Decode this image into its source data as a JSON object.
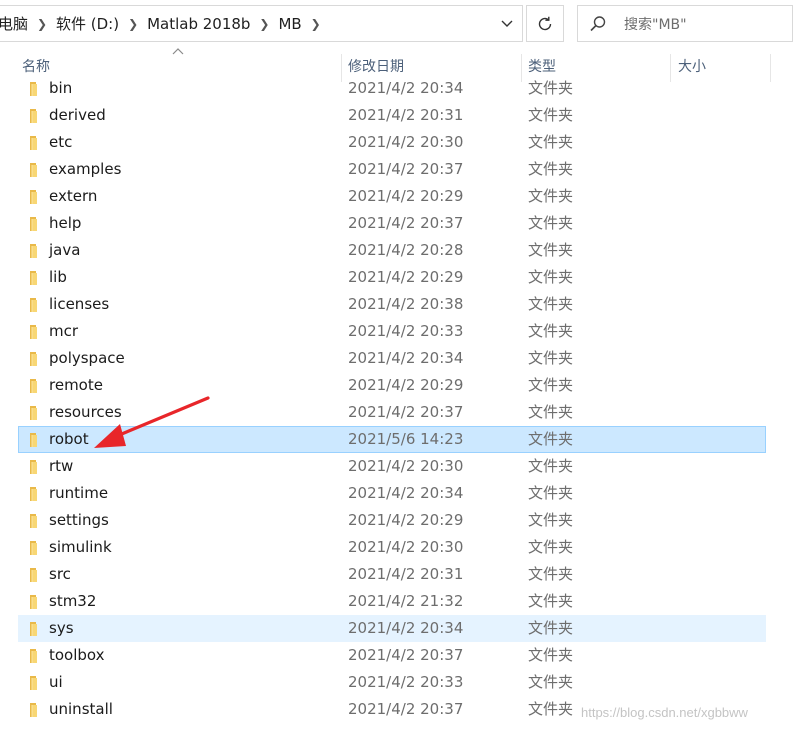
{
  "address": {
    "crumbs": [
      "电脑",
      "软件 (D:)",
      "Matlab 2018b",
      "MB"
    ]
  },
  "search": {
    "placeholder": "搜索\"MB\""
  },
  "columns": {
    "name": "名称",
    "date": "修改日期",
    "type": "类型",
    "size": "大小"
  },
  "rows": [
    {
      "name": "bin",
      "date": "2021/4/2 20:34",
      "type": "文件夹"
    },
    {
      "name": "derived",
      "date": "2021/4/2 20:31",
      "type": "文件夹"
    },
    {
      "name": "etc",
      "date": "2021/4/2 20:30",
      "type": "文件夹"
    },
    {
      "name": "examples",
      "date": "2021/4/2 20:37",
      "type": "文件夹"
    },
    {
      "name": "extern",
      "date": "2021/4/2 20:29",
      "type": "文件夹"
    },
    {
      "name": "help",
      "date": "2021/4/2 20:37",
      "type": "文件夹"
    },
    {
      "name": "java",
      "date": "2021/4/2 20:28",
      "type": "文件夹"
    },
    {
      "name": "lib",
      "date": "2021/4/2 20:29",
      "type": "文件夹"
    },
    {
      "name": "licenses",
      "date": "2021/4/2 20:38",
      "type": "文件夹"
    },
    {
      "name": "mcr",
      "date": "2021/4/2 20:33",
      "type": "文件夹"
    },
    {
      "name": "polyspace",
      "date": "2021/4/2 20:34",
      "type": "文件夹"
    },
    {
      "name": "remote",
      "date": "2021/4/2 20:29",
      "type": "文件夹"
    },
    {
      "name": "resources",
      "date": "2021/4/2 20:37",
      "type": "文件夹"
    },
    {
      "name": "robot",
      "date": "2021/5/6 14:23",
      "type": "文件夹",
      "state": "selected"
    },
    {
      "name": "rtw",
      "date": "2021/4/2 20:30",
      "type": "文件夹"
    },
    {
      "name": "runtime",
      "date": "2021/4/2 20:34",
      "type": "文件夹"
    },
    {
      "name": "settings",
      "date": "2021/4/2 20:29",
      "type": "文件夹"
    },
    {
      "name": "simulink",
      "date": "2021/4/2 20:30",
      "type": "文件夹"
    },
    {
      "name": "src",
      "date": "2021/4/2 20:31",
      "type": "文件夹"
    },
    {
      "name": "stm32",
      "date": "2021/4/2 21:32",
      "type": "文件夹"
    },
    {
      "name": "sys",
      "date": "2021/4/2 20:34",
      "type": "文件夹",
      "state": "hovered"
    },
    {
      "name": "toolbox",
      "date": "2021/4/2 20:37",
      "type": "文件夹"
    },
    {
      "name": "ui",
      "date": "2021/4/2 20:33",
      "type": "文件夹"
    },
    {
      "name": "uninstall",
      "date": "2021/4/2 20:37",
      "type": "文件夹"
    }
  ],
  "watermark": "https://blog.csdn.net/xgbbww",
  "icons": {
    "folder": "folder-icon",
    "breadcrumb_separator": "chevron-right-icon",
    "address_dropdown": "chevron-down-icon",
    "refresh": "refresh-icon",
    "search": "search-icon",
    "sort": "sort-ascending-icon",
    "annotation": "red-arrow-icon"
  },
  "colors": {
    "selected_bg": "#cce8ff",
    "selected_border": "#99d1ff",
    "hover_bg": "#e5f3ff",
    "folder": "#f8d775",
    "arrow": "#e8262a",
    "header_text": "#4c607a"
  }
}
